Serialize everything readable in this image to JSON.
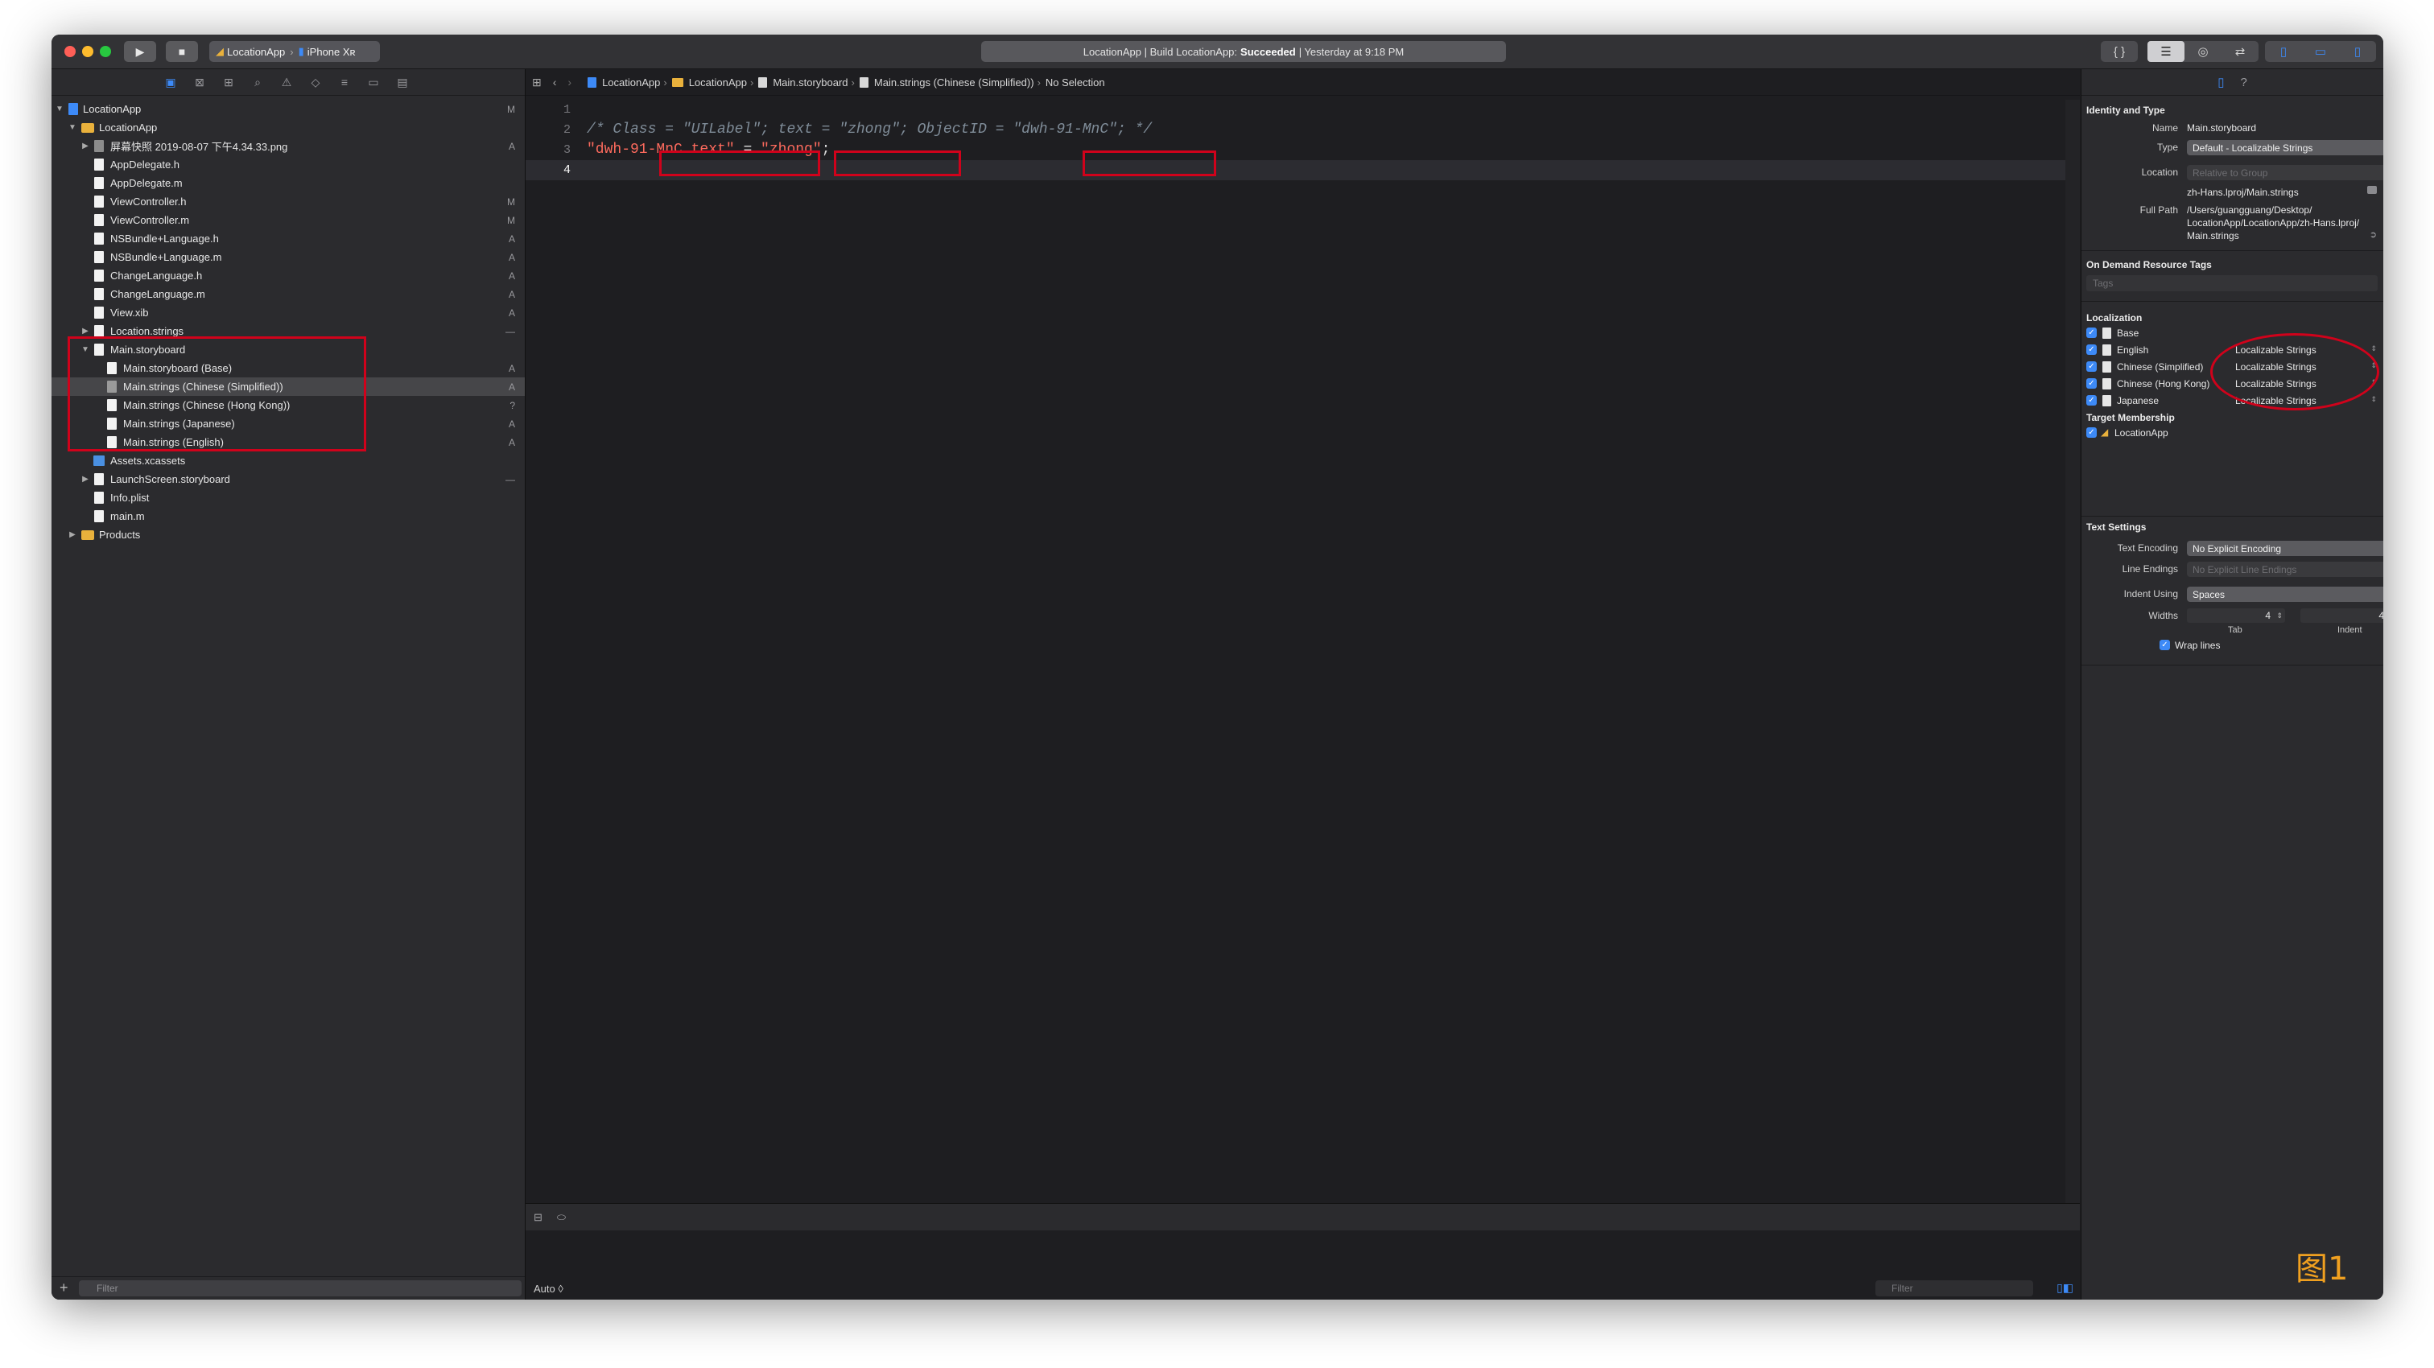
{
  "toolbar": {
    "scheme_target": "LocationApp",
    "scheme_device": "iPhone Xʀ",
    "activity_prefix": "LocationApp | Build LocationApp:",
    "activity_status": "Succeeded",
    "activity_suffix": "| Yesterday at 9:18 PM"
  },
  "navigator": {
    "items": [
      {
        "label": "LocationApp",
        "status": "M"
      },
      {
        "label": "LocationApp",
        "status": ""
      },
      {
        "label": "屏幕快照 2019-08-07 下午4.34.33.png",
        "status": "A"
      },
      {
        "label": "AppDelegate.h",
        "status": ""
      },
      {
        "label": "AppDelegate.m",
        "status": ""
      },
      {
        "label": "ViewController.h",
        "status": "M"
      },
      {
        "label": "ViewController.m",
        "status": "M"
      },
      {
        "label": "NSBundle+Language.h",
        "status": "A"
      },
      {
        "label": "NSBundle+Language.m",
        "status": "A"
      },
      {
        "label": "ChangeLanguage.h",
        "status": "A"
      },
      {
        "label": "ChangeLanguage.m",
        "status": "A"
      },
      {
        "label": "View.xib",
        "status": "A"
      },
      {
        "label": "Location.strings",
        "status": "—"
      },
      {
        "label": "Main.storyboard",
        "status": ""
      },
      {
        "label": "Main.storyboard (Base)",
        "status": "A"
      },
      {
        "label": "Main.strings (Chinese (Simplified))",
        "status": "A"
      },
      {
        "label": "Main.strings (Chinese (Hong Kong))",
        "status": "?"
      },
      {
        "label": "Main.strings (Japanese)",
        "status": "A"
      },
      {
        "label": "Main.strings (English)",
        "status": "A"
      },
      {
        "label": "Assets.xcassets",
        "status": ""
      },
      {
        "label": "LaunchScreen.storyboard",
        "status": "—"
      },
      {
        "label": "Info.plist",
        "status": ""
      },
      {
        "label": "main.m",
        "status": ""
      },
      {
        "label": "Products",
        "status": ""
      }
    ],
    "filter_placeholder": "Filter"
  },
  "editor": {
    "breadcrumb": [
      "LocationApp",
      "LocationApp",
      "Main.storyboard",
      "Main.strings (Chinese (Simplified))",
      "No Selection"
    ],
    "line_numbers": [
      "1",
      "2",
      "3",
      "4"
    ],
    "code": {
      "c1": "/* ",
      "c2": "Class = \"UILabel\"",
      "c3": "; ",
      "c4": "text = \"zhong\"",
      "c5": "; ObjectID = ",
      "c6": "\"dwh-91-MnC\";",
      "c7": " */",
      "k1": "\"dwh-91-MnC.text\"",
      "k2": " = ",
      "k3": "\"zhong\"",
      "k4": ";"
    },
    "console_mode": "Auto ◊",
    "console_filter": "Filter"
  },
  "inspector": {
    "identity_title": "Identity and Type",
    "name_label": "Name",
    "name_value": "Main.storyboard",
    "type_label": "Type",
    "type_value": "Default - Localizable Strings",
    "location_label": "Location",
    "location_value": "Relative to Group",
    "location_path": "zh-Hans.lproj/Main.strings",
    "fullpath_label": "Full Path",
    "fullpath_1": "/Users/guangguang/Desktop/",
    "fullpath_2": "LocationApp/LocationApp/zh-Hans.lproj/",
    "fullpath_3": "Main.strings",
    "odr_title": "On Demand Resource Tags",
    "tags_placeholder": "Tags",
    "localization_title": "Localization",
    "localizations": [
      {
        "name": "Base",
        "type": ""
      },
      {
        "name": "English",
        "type": "Localizable Strings"
      },
      {
        "name": "Chinese (Simplified)",
        "type": "Localizable Strings"
      },
      {
        "name": "Chinese (Hong Kong)",
        "type": "Localizable Strings"
      },
      {
        "name": "Japanese",
        "type": "Localizable Strings"
      }
    ],
    "target_title": "Target Membership",
    "target_name": "LocationApp",
    "text_settings_title": "Text Settings",
    "encoding_label": "Text Encoding",
    "encoding_value": "No Explicit Encoding",
    "line_endings_label": "Line Endings",
    "line_endings_value": "No Explicit Line Endings",
    "indent_label": "Indent Using",
    "indent_value": "Spaces",
    "widths_label": "Widths",
    "tab_value": "4",
    "indent_value_num": "4",
    "tab_caption": "Tab",
    "indent_caption": "Indent",
    "wrap_label": "Wrap lines"
  },
  "watermark": "图1",
  "colors": {
    "accent": "#3d8af7",
    "annotation_red": "#d0021b",
    "string_red": "#fc6a5d",
    "comment_gray": "#7f8c98",
    "watermark": "#f0a020"
  }
}
